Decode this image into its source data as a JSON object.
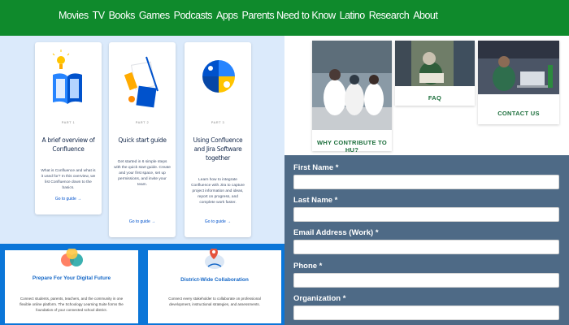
{
  "nav": {
    "items": [
      "Movies",
      "TV",
      "Books",
      "Games",
      "Podcasts",
      "Apps",
      "Parents Need to Know",
      "Latino",
      "Research",
      "About"
    ]
  },
  "guides": [
    {
      "part": "PART 1",
      "title": "A brief overview of Confluence",
      "desc": "What is Confluence and what is it used for? In this overview, we list Confluence down to the basics.",
      "link": "Go to guide →"
    },
    {
      "part": "PART 2",
      "title": "Quick start guide",
      "desc": "Get started in 6 simple steps with the quick start guide. Create and your first space, set up permissions, and invite your team.",
      "link": "Go to guide →"
    },
    {
      "part": "PART 3",
      "title": "Using Confluence and Jira Software together",
      "desc": "Learn how to integrate Confluence with Jira to capture project information and ideas, report on progress, and complete work faster.",
      "link": "Go to guide →"
    }
  ],
  "features": [
    {
      "title": "Prepare For Your Digital Future",
      "desc": "Connect students, parents, teachers, and the community in one flexible online platform. The Schoology Learning Suite forms the foundation of your connected school district."
    },
    {
      "title": "District-Wide Collaboration",
      "desc": "Connect every stakeholder to collaborate on professional development, instructional strategies, and assessments."
    }
  ],
  "tiles": {
    "contribute": "WHY CONTRIBUTE TO HU?",
    "faq": "FAQ",
    "contact": "CONTACT US"
  },
  "form": {
    "fields": [
      "First Name *",
      "Last Name *",
      "Email Address (Work) *",
      "Phone *",
      "Organization *"
    ]
  },
  "colors": {
    "nav_green": "#0f8a2c",
    "guides_bg": "#dbeafb",
    "features_bg": "#0b76d8",
    "form_bg": "#4e6a86",
    "tile_label_green": "#1b6e3b"
  }
}
